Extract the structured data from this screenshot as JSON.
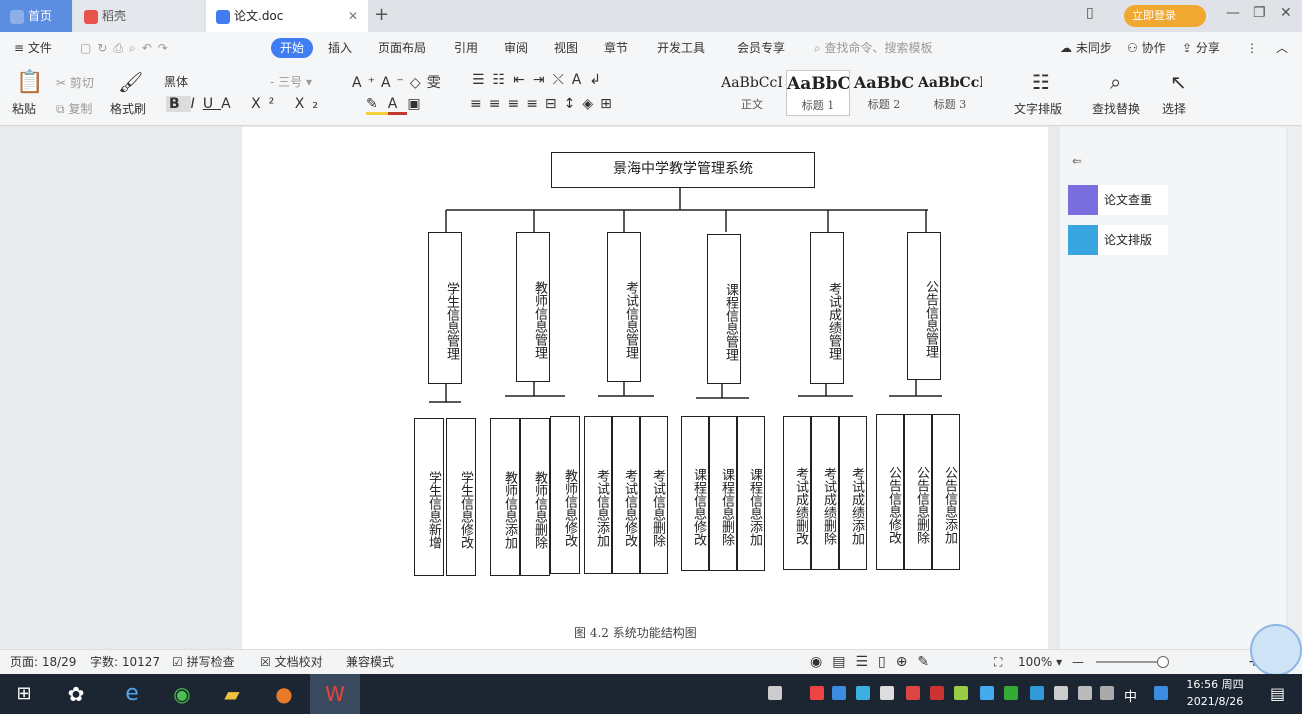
{
  "tabs": [
    {
      "label": "首页"
    },
    {
      "label": "稻壳"
    },
    {
      "label": "论文.doc"
    }
  ],
  "login_label": "立即登录",
  "menus": [
    "文件",
    "开始",
    "插入",
    "页面布局",
    "引用",
    "审阅",
    "视图",
    "章节",
    "开发工具",
    "会员专享"
  ],
  "search_placeholder": "查找命令、搜索模板",
  "menu_right": {
    "sync": "未同步",
    "collab": "协作",
    "share": "分享"
  },
  "ribbon": {
    "paste": "粘贴",
    "cut": "剪切",
    "copy": "复制",
    "format_painter": "格式刷",
    "font": "黑体",
    "font_size": "三号",
    "styles": [
      {
        "sample": "AaBbCcI",
        "label": "正文"
      },
      {
        "sample": "AaBbC",
        "label": "标题 1"
      },
      {
        "sample": "AaBbC",
        "label": "标题 2"
      },
      {
        "sample": "AaBbCcI",
        "label": "标题 3"
      }
    ],
    "text_layout": "文字排版",
    "find_replace": "查找替换",
    "select": "选择"
  },
  "diagram": {
    "root": "景海中学教学管理系统",
    "modules": [
      {
        "title": "学生信息管理",
        "children": [
          "学生信息新增",
          "学生信息修改"
        ]
      },
      {
        "title": "教师信息管理",
        "children": [
          "教师信息添加",
          "教师信息删除",
          "教师信息修改"
        ]
      },
      {
        "title": "考试信息管理",
        "children": [
          "考试信息添加",
          "考试信息修改",
          "考试信息删除"
        ]
      },
      {
        "title": "课程信息管理",
        "children": [
          "课程信息修改",
          "课程信息删除",
          "课程信息添加"
        ]
      },
      {
        "title": "考试成绩管理",
        "children": [
          "考试成绩删改",
          "考试成绩删除",
          "考试成绩添加"
        ]
      },
      {
        "title": "公告信息管理",
        "children": [
          "公告信息修改",
          "公告信息删除",
          "公告信息添加"
        ]
      }
    ],
    "caption": "图 4.2  系统功能结构图"
  },
  "right_panel": {
    "items": [
      "论文查重",
      "论文排版"
    ]
  },
  "status": {
    "page": "页面: 18/29",
    "words": "字数: 10127",
    "spell": "拼写检查",
    "proof": "文档校对",
    "compat": "兼容模式",
    "zoom": "100%"
  },
  "clock": {
    "time": "16:56 周四",
    "date": "2021/8/26"
  },
  "tray_ime": "中",
  "colors": {
    "accent": "#3f7df1",
    "tab_home": "#5b8de0",
    "taskbar": "#1c2633"
  }
}
